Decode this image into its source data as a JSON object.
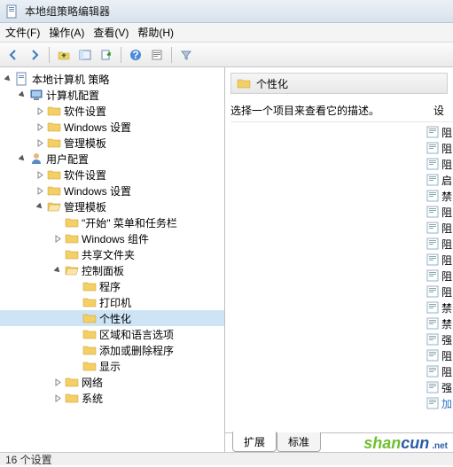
{
  "title": "本地组策略编辑器",
  "menu": {
    "file": "文件(F)",
    "action": "操作(A)",
    "view": "查看(V)",
    "help": "帮助(H)"
  },
  "tree": {
    "root": "本地计算机 策略",
    "comp_cfg": "计算机配置",
    "c_soft": "软件设置",
    "c_win": "Windows 设置",
    "c_admin": "管理模板",
    "user_cfg": "用户配置",
    "u_soft": "软件设置",
    "u_win": "Windows 设置",
    "u_admin": "管理模板",
    "start_menu": "\"开始\" 菜单和任务栏",
    "win_comp": "Windows 组件",
    "shared": "共享文件夹",
    "cpanel": "控制面板",
    "programs": "程序",
    "printers": "打印机",
    "personal": "个性化",
    "region": "区域和语言选项",
    "addremove": "添加或删除程序",
    "display": "显示",
    "network": "网络",
    "system": "系统"
  },
  "right": {
    "title": "个性化",
    "desc_header": "选择一个项目来查看它的描述。",
    "set_header": "设",
    "items": [
      "阻",
      "阻",
      "阻",
      "启",
      "禁",
      "阻",
      "阻",
      "阻",
      "阻",
      "阻",
      "阻",
      "禁",
      "禁",
      "强",
      "阻",
      "阻",
      "强",
      "加"
    ],
    "tab_ext": "扩展",
    "tab_std": "标准"
  },
  "status": "16 个设置",
  "watermark": {
    "p1": "shan",
    "p2": "cun",
    "suffix": ".net"
  }
}
